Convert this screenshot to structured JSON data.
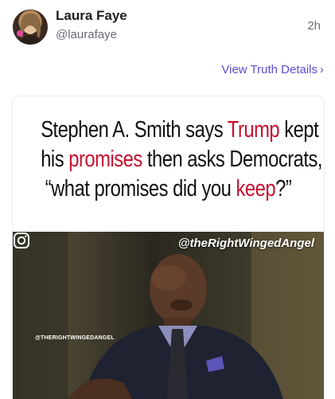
{
  "post": {
    "display_name": "Laura Faye",
    "handle": "@laurafaye",
    "timestamp": "2h",
    "details_link": "View Truth Details",
    "details_chevron": "›"
  },
  "media": {
    "headline": {
      "line1_a": "Stephen A. Smith says ",
      "line1_red": "Trump",
      "line1_b": " kept",
      "line2_a": "his ",
      "line2_red": "promises",
      "line2_b": " then asks Democrats,",
      "line3_a": "“what promises did you ",
      "line3_red": "keep",
      "line3_b": "?”"
    },
    "watermark": "@theRightWingedAngel",
    "ig_handle": "@THERIGHTWINGEDANGEL"
  },
  "colors": {
    "accent": "#5a4ed1",
    "headline_red": "#c8102e"
  },
  "icons": {
    "details_chevron": "chevron-right-icon",
    "instagram": "instagram-icon"
  }
}
